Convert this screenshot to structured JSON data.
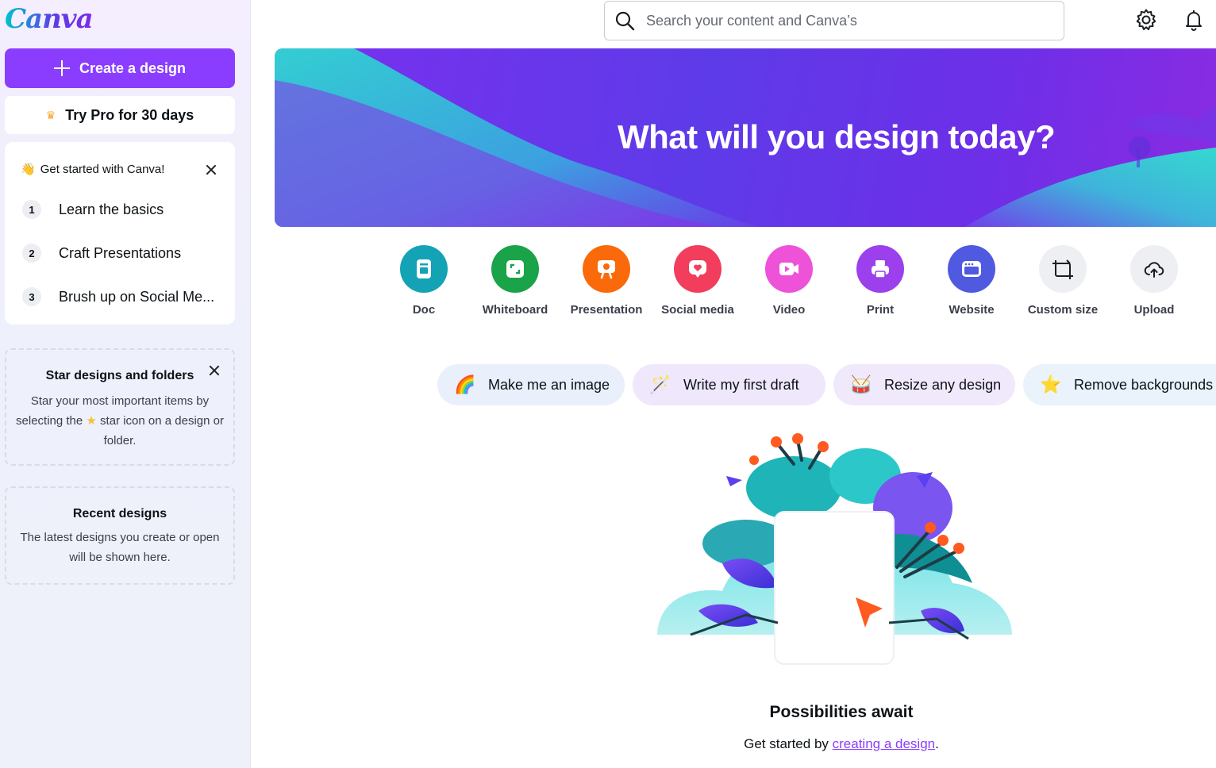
{
  "app": {
    "logo_text": "Canva"
  },
  "sidebar": {
    "create_label": "Create a design",
    "pro_label": "Try Pro for 30 days",
    "get_started": {
      "title": "Get started with Canva!",
      "steps": [
        {
          "num": "1",
          "label": "Learn the basics"
        },
        {
          "num": "2",
          "label": "Craft Presentations"
        },
        {
          "num": "3",
          "label": "Brush up on Social Me..."
        }
      ]
    },
    "star_card": {
      "title": "Star designs and folders",
      "text_before": "Star your most important items by selecting the",
      "text_after": "star icon on a design or folder."
    },
    "recent_card": {
      "title": "Recent designs",
      "text": "The latest designs you create or open will be shown here."
    }
  },
  "search": {
    "placeholder": "Search your content and Canva’s"
  },
  "header_icons": [
    "settings-gear-icon",
    "notification-bell-icon"
  ],
  "hero": {
    "title": "What will you design today?"
  },
  "categories": [
    {
      "label": "Doc",
      "color": "#13a3b5",
      "icon": "doc-icon"
    },
    {
      "label": "Whiteboard",
      "color": "#1ba34a",
      "icon": "whiteboard-icon"
    },
    {
      "label": "Presentation",
      "color": "#fa6a0a",
      "icon": "presentation-icon"
    },
    {
      "label": "Social media",
      "color": "#f23d5c",
      "icon": "heart-icon"
    },
    {
      "label": "Video",
      "color": "#ee52d9",
      "icon": "video-icon"
    },
    {
      "label": "Print",
      "color": "#9b40ec",
      "icon": "print-icon"
    },
    {
      "label": "Website",
      "color": "#4f5ae0",
      "icon": "website-icon"
    },
    {
      "label": "Custom size",
      "color": "#eeeff2",
      "icon": "custom-size-icon"
    },
    {
      "label": "Upload",
      "color": "#eeeff2",
      "icon": "upload-cloud-icon"
    }
  ],
  "pills": [
    {
      "label": "Make me an image",
      "emoji": "🌈",
      "bg": "#eaf0fb"
    },
    {
      "label": "Write my first draft",
      "emoji": "🪄",
      "bg": "#efe8fc"
    },
    {
      "label": "Resize any design",
      "emoji": "🥁",
      "bg": "#f0e9fb"
    },
    {
      "label": "Remove backgrounds",
      "emoji": "⭐",
      "bg": "#eaf2fb"
    }
  ],
  "empty_state": {
    "title": "Possibilities await",
    "sub_prefix": "Get started by",
    "link": "creating a design",
    "sub_suffix": "."
  },
  "colors": {
    "accent": "#8b3dff",
    "hero_start": "#7b2ff0",
    "hero_teal": "#23d0d6"
  }
}
